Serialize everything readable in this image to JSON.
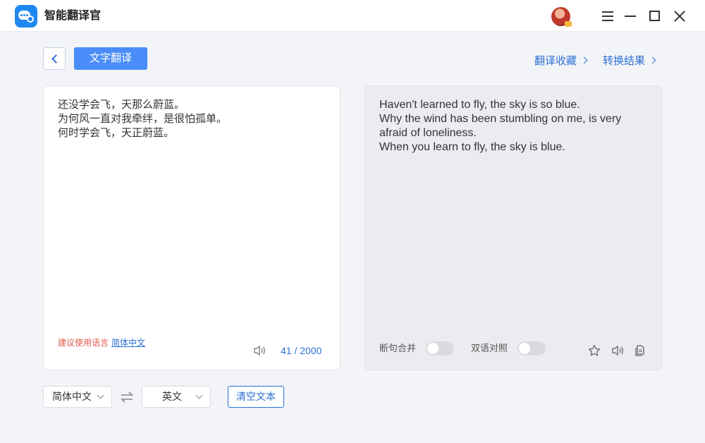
{
  "app": {
    "title": "智能翻译官"
  },
  "toolbar": {
    "mode_tab": "文字翻译",
    "favorites_link": "翻译收藏",
    "results_link": "转换结果"
  },
  "source": {
    "lines": [
      "还没学会飞，天那么蔚蓝。",
      "为何风一直对我牵绊，是很怕孤单。",
      "何时学会飞，天正蔚蓝。"
    ],
    "suggest_label": "建议使用语言",
    "suggest_lang": "简体中文",
    "char_count": "41 / 2000"
  },
  "target": {
    "lines": [
      "Haven't learned to fly, the sky is so blue.",
      "Why the wind has been stumbling on me, is very afraid of loneliness.",
      "When you learn to fly, the sky is blue."
    ],
    "toggle_merge_label": "断句合并",
    "toggle_bilingual_label": "双语对照"
  },
  "bottom": {
    "source_lang": "简体中文",
    "target_lang": "英文",
    "clear_button": "清空文本"
  },
  "icons": {
    "logo": "chat-bubble-icon",
    "speaker": "speaker-icon",
    "star": "star-icon",
    "copy": "copy-icon",
    "swap": "swap-icon"
  },
  "colors": {
    "accent": "#2a6fd6",
    "tab_bg": "#4b8df8",
    "suggest_red": "#e05a4c"
  }
}
